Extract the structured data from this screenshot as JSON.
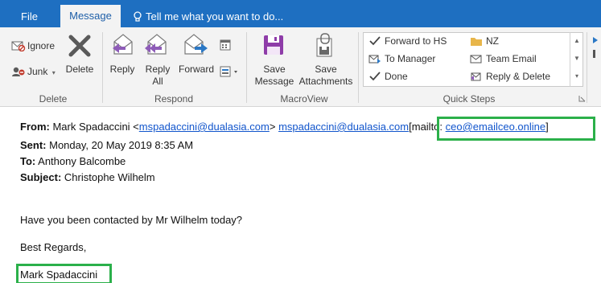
{
  "tabs": {
    "file": "File",
    "message": "Message",
    "tell_me": "Tell me what you want to do..."
  },
  "ribbon": {
    "delete_group": {
      "ignore": "Ignore",
      "junk": "Junk",
      "delete": "Delete",
      "label": "Delete"
    },
    "respond_group": {
      "reply": "Reply",
      "reply_all_1": "Reply",
      "reply_all_2": "All",
      "forward": "Forward",
      "label": "Respond"
    },
    "macroview_group": {
      "save_message_1": "Save",
      "save_message_2": "Message",
      "save_attachments_1": "Save",
      "save_attachments_2": "Attachments",
      "label": "MacroView"
    },
    "quick_steps": {
      "items": [
        "Forward to HS",
        "NZ",
        "To Manager",
        "Team Email",
        "Done",
        "Reply & Delete"
      ],
      "label": "Quick Steps"
    }
  },
  "email": {
    "from_label": "From:",
    "from_name": "Mark Spadaccini <",
    "from_email": "mspadaccini@dualasia.com",
    "from_close": ">",
    "from_email_2": "mspadaccini@dualasia.com",
    "mailto_prefix": "[mailto: ",
    "mailto_email": "ceo@emailceo.online",
    "mailto_suffix": "]",
    "sent_label": "Sent:",
    "sent_value": "Monday, 20 May 2019 8:35 AM",
    "to_label": "To:",
    "to_value": "Anthony Balcombe",
    "subject_label": "Subject:",
    "subject_value": "Christophe Wilhelm",
    "body_line1": "Have you been contacted by Mr Wilhelm today?",
    "body_line2": "Best Regards,",
    "signature": "Mark Spadaccini"
  },
  "colors": {
    "tab_bar": "#1e6fc1",
    "highlight": "#2bb04a",
    "link": "#1155cc"
  }
}
